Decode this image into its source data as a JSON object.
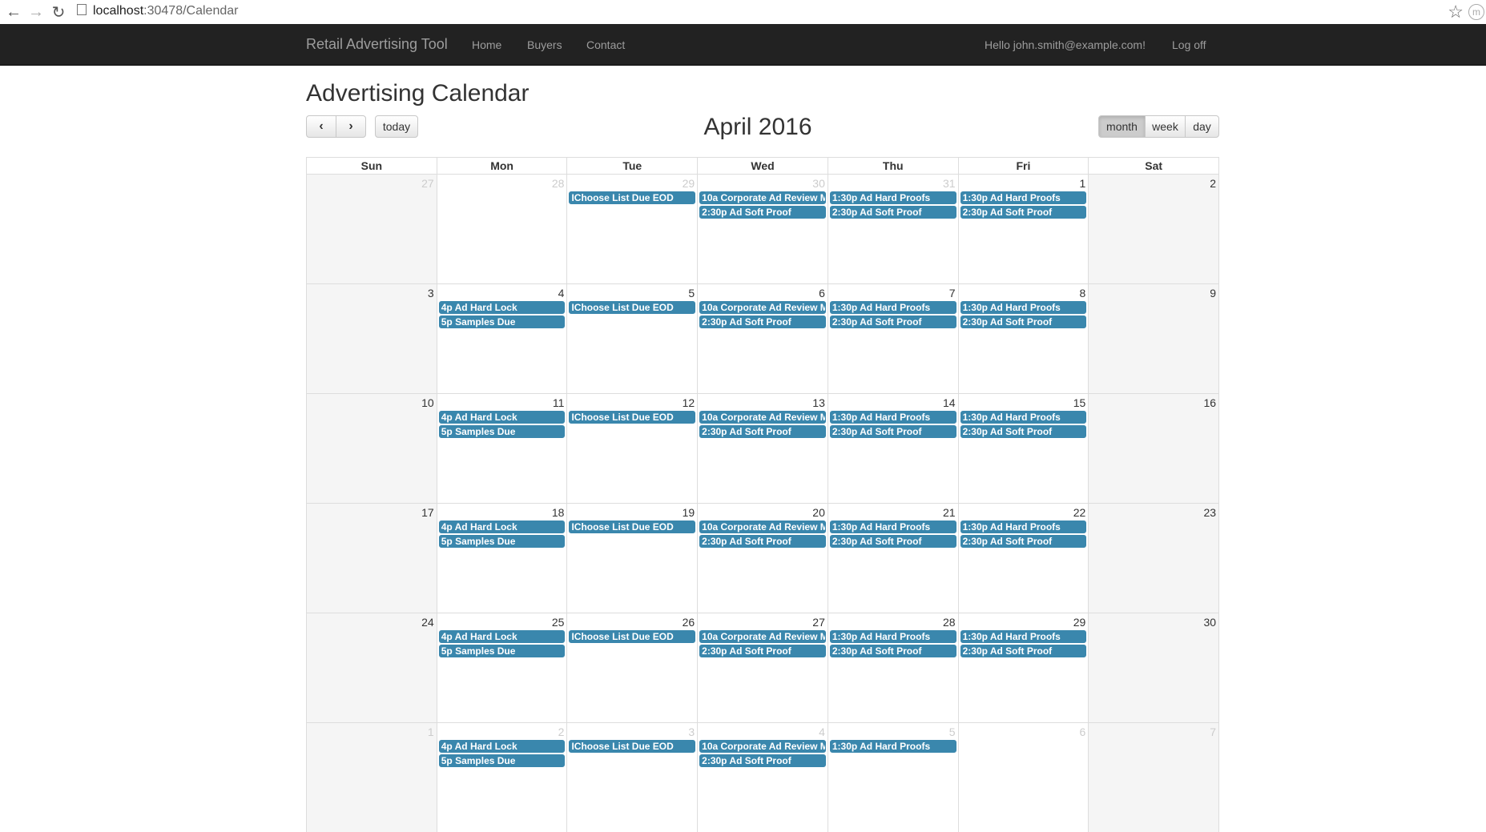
{
  "browser": {
    "url_host": "localhost",
    "url_path": ":30478/Calendar",
    "back_icon": "arrow-left-icon",
    "forward_icon": "arrow-right-icon",
    "reload_icon": "reload-icon",
    "profile_initial": "m"
  },
  "navbar": {
    "brand": "Retail Advertising Tool",
    "links": [
      "Home",
      "Buyers",
      "Contact"
    ],
    "greeting": "Hello john.smith@example.com!",
    "logoff": "Log off",
    "background": "#222222"
  },
  "calendar": {
    "page_title": "Advertising Calendar",
    "month_title": "April 2016",
    "today_label": "today",
    "views": [
      "month",
      "week",
      "day"
    ],
    "active_view": "month",
    "event_color": "#3a87ad",
    "days_of_week": [
      "Sun",
      "Mon",
      "Tue",
      "Wed",
      "Thu",
      "Fri",
      "Sat"
    ],
    "weeks": [
      {
        "days": [
          {
            "n": "27",
            "other": true,
            "events": []
          },
          {
            "n": "28",
            "other": true,
            "events": []
          },
          {
            "n": "29",
            "other": true,
            "events": [
              {
                "t": "",
                "title": "IChoose List Due EOD"
              }
            ]
          },
          {
            "n": "30",
            "other": true,
            "events": [
              {
                "t": "10a",
                "title": "Corporate Ad Review M"
              },
              {
                "t": "2:30p",
                "title": "Ad Soft Proof"
              }
            ]
          },
          {
            "n": "31",
            "other": true,
            "events": [
              {
                "t": "1:30p",
                "title": "Ad Hard Proofs"
              },
              {
                "t": "2:30p",
                "title": "Ad Soft Proof"
              }
            ]
          },
          {
            "n": "1",
            "other": false,
            "events": [
              {
                "t": "1:30p",
                "title": "Ad Hard Proofs"
              },
              {
                "t": "2:30p",
                "title": "Ad Soft Proof"
              }
            ]
          },
          {
            "n": "2",
            "other": false,
            "events": []
          }
        ]
      },
      {
        "days": [
          {
            "n": "3",
            "other": false,
            "events": []
          },
          {
            "n": "4",
            "other": false,
            "events": [
              {
                "t": "4p",
                "title": "Ad Hard Lock"
              },
              {
                "t": "5p",
                "title": "Samples Due"
              }
            ]
          },
          {
            "n": "5",
            "other": false,
            "events": [
              {
                "t": "",
                "title": "IChoose List Due EOD"
              }
            ]
          },
          {
            "n": "6",
            "other": false,
            "events": [
              {
                "t": "10a",
                "title": "Corporate Ad Review M"
              },
              {
                "t": "2:30p",
                "title": "Ad Soft Proof"
              }
            ]
          },
          {
            "n": "7",
            "other": false,
            "events": [
              {
                "t": "1:30p",
                "title": "Ad Hard Proofs"
              },
              {
                "t": "2:30p",
                "title": "Ad Soft Proof"
              }
            ]
          },
          {
            "n": "8",
            "other": false,
            "events": [
              {
                "t": "1:30p",
                "title": "Ad Hard Proofs"
              },
              {
                "t": "2:30p",
                "title": "Ad Soft Proof"
              }
            ]
          },
          {
            "n": "9",
            "other": false,
            "events": []
          }
        ]
      },
      {
        "days": [
          {
            "n": "10",
            "other": false,
            "events": []
          },
          {
            "n": "11",
            "other": false,
            "events": [
              {
                "t": "4p",
                "title": "Ad Hard Lock"
              },
              {
                "t": "5p",
                "title": "Samples Due"
              }
            ]
          },
          {
            "n": "12",
            "other": false,
            "events": [
              {
                "t": "",
                "title": "IChoose List Due EOD"
              }
            ]
          },
          {
            "n": "13",
            "other": false,
            "events": [
              {
                "t": "10a",
                "title": "Corporate Ad Review M"
              },
              {
                "t": "2:30p",
                "title": "Ad Soft Proof"
              }
            ]
          },
          {
            "n": "14",
            "other": false,
            "events": [
              {
                "t": "1:30p",
                "title": "Ad Hard Proofs"
              },
              {
                "t": "2:30p",
                "title": "Ad Soft Proof"
              }
            ]
          },
          {
            "n": "15",
            "other": false,
            "events": [
              {
                "t": "1:30p",
                "title": "Ad Hard Proofs"
              },
              {
                "t": "2:30p",
                "title": "Ad Soft Proof"
              }
            ]
          },
          {
            "n": "16",
            "other": false,
            "events": []
          }
        ]
      },
      {
        "days": [
          {
            "n": "17",
            "other": false,
            "events": []
          },
          {
            "n": "18",
            "other": false,
            "events": [
              {
                "t": "4p",
                "title": "Ad Hard Lock"
              },
              {
                "t": "5p",
                "title": "Samples Due"
              }
            ]
          },
          {
            "n": "19",
            "other": false,
            "events": [
              {
                "t": "",
                "title": "IChoose List Due EOD"
              }
            ]
          },
          {
            "n": "20",
            "other": false,
            "events": [
              {
                "t": "10a",
                "title": "Corporate Ad Review M"
              },
              {
                "t": "2:30p",
                "title": "Ad Soft Proof"
              }
            ]
          },
          {
            "n": "21",
            "other": false,
            "events": [
              {
                "t": "1:30p",
                "title": "Ad Hard Proofs"
              },
              {
                "t": "2:30p",
                "title": "Ad Soft Proof"
              }
            ]
          },
          {
            "n": "22",
            "other": false,
            "events": [
              {
                "t": "1:30p",
                "title": "Ad Hard Proofs"
              },
              {
                "t": "2:30p",
                "title": "Ad Soft Proof"
              }
            ]
          },
          {
            "n": "23",
            "other": false,
            "events": []
          }
        ]
      },
      {
        "days": [
          {
            "n": "24",
            "other": false,
            "events": []
          },
          {
            "n": "25",
            "other": false,
            "events": [
              {
                "t": "4p",
                "title": "Ad Hard Lock"
              },
              {
                "t": "5p",
                "title": "Samples Due"
              }
            ]
          },
          {
            "n": "26",
            "other": false,
            "events": [
              {
                "t": "",
                "title": "IChoose List Due EOD"
              }
            ]
          },
          {
            "n": "27",
            "other": false,
            "events": [
              {
                "t": "10a",
                "title": "Corporate Ad Review M"
              },
              {
                "t": "2:30p",
                "title": "Ad Soft Proof"
              }
            ]
          },
          {
            "n": "28",
            "other": false,
            "events": [
              {
                "t": "1:30p",
                "title": "Ad Hard Proofs"
              },
              {
                "t": "2:30p",
                "title": "Ad Soft Proof"
              }
            ]
          },
          {
            "n": "29",
            "other": false,
            "events": [
              {
                "t": "1:30p",
                "title": "Ad Hard Proofs"
              },
              {
                "t": "2:30p",
                "title": "Ad Soft Proof"
              }
            ]
          },
          {
            "n": "30",
            "other": false,
            "events": []
          }
        ]
      },
      {
        "days": [
          {
            "n": "1",
            "other": true,
            "events": []
          },
          {
            "n": "2",
            "other": true,
            "events": [
              {
                "t": "4p",
                "title": "Ad Hard Lock"
              },
              {
                "t": "5p",
                "title": "Samples Due"
              }
            ]
          },
          {
            "n": "3",
            "other": true,
            "events": [
              {
                "t": "",
                "title": "IChoose List Due EOD"
              }
            ]
          },
          {
            "n": "4",
            "other": true,
            "events": [
              {
                "t": "10a",
                "title": "Corporate Ad Review M"
              },
              {
                "t": "2:30p",
                "title": "Ad Soft Proof"
              }
            ]
          },
          {
            "n": "5",
            "other": true,
            "events": [
              {
                "t": "1:30p",
                "title": "Ad Hard Proofs"
              }
            ]
          },
          {
            "n": "6",
            "other": true,
            "events": []
          },
          {
            "n": "7",
            "other": true,
            "events": []
          }
        ]
      }
    ]
  }
}
